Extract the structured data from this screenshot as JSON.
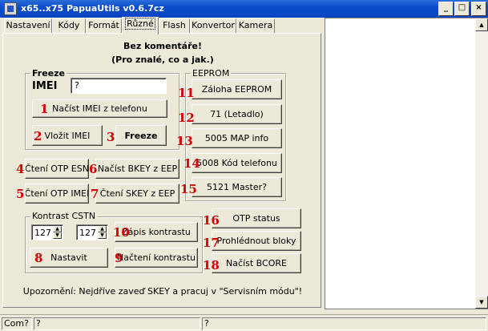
{
  "window": {
    "title": "x65..x75 PapuaUtils v0.6.7cz"
  },
  "tabs": [
    {
      "label": "Nastavení"
    },
    {
      "label": "Kódy"
    },
    {
      "label": "Formát"
    },
    {
      "label": "Různé"
    },
    {
      "label": "Flash"
    },
    {
      "label": "Konvertor"
    },
    {
      "label": "Kamera"
    }
  ],
  "header": {
    "line1": "Bez komentáře!",
    "line2": "(Pro znalé, co a jak.)"
  },
  "freeze": {
    "group_label": "Freeze",
    "imei_label": "IMEI",
    "imei_value": "?",
    "read_imei": "Načíst IMEI z telefonu",
    "insert_imei": "Vložit IMEI",
    "freeze": "Freeze"
  },
  "otp": {
    "read_otp_esn": "Čtení OTP ESN",
    "read_bkey": "Načíst BKEY z EEP",
    "read_otp_imei": "Čtení OTP IMEI",
    "read_skey": "Čtení SKEY z EEP"
  },
  "eeprom": {
    "group_label": "EEPROM",
    "backup": "Záloha EEPROM",
    "b71": "71 (Letadlo)",
    "b5005": "5005 MAP info",
    "b5008": "5008 Kód telefonu",
    "b5121": "5121 Master?"
  },
  "contrast": {
    "group_label": "Kontrast CSTN",
    "value1": "127",
    "value2": "127",
    "write": "Zápis kontrastu",
    "set": "Nastavit",
    "read": "Načtení kontrastu"
  },
  "misc": {
    "otp_status": "OTP status",
    "view_blocks": "Prohlédnout bloky",
    "read_bcore": "Načíst  BCORE"
  },
  "warning": "Upozornění: Nejdříve zaveď SKEY a pracuj v \"Servisním módu\"!",
  "markers": [
    "1",
    "2",
    "3",
    "4",
    "5",
    "6",
    "7",
    "8",
    "9",
    "10",
    "11",
    "12",
    "13",
    "14",
    "15",
    "16",
    "17",
    "18"
  ],
  "statusbar": {
    "com": "Com?",
    "field2": "?",
    "field3": "?"
  },
  "colors": {
    "marker": "#d40000",
    "titlebar": "#0a4ccb"
  }
}
